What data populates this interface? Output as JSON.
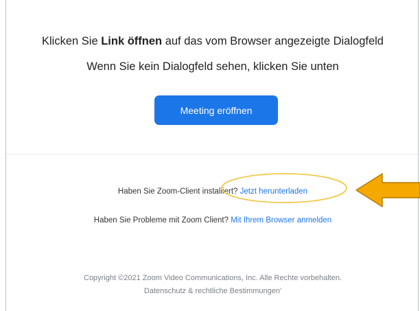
{
  "prompt": {
    "line1_prefix": "Klicken Sie ",
    "line1_bold": "Link öffnen",
    "line1_suffix": " auf das vom Browser angezeigte Dialogfeld",
    "line2": "Wenn Sie kein Dialogfeld sehen, klicken Sie unten"
  },
  "launch_button_label": "Meeting eröffnen",
  "download_row": {
    "question": "Haben Sie Zoom-Client installiert? ",
    "link": "Jetzt herunterladen"
  },
  "browser_row": {
    "question": "Haben Sie Probleme mit Zoom Client? ",
    "link": "Mit Ihrem Browser anmelden"
  },
  "footer": {
    "copyright": "Copyright ©2021 Zoom Video Communications, Inc. Alle Rechte vorbehalten.",
    "legal": "Datenschutz & rechtliche Bestimmungen'"
  },
  "annotation": {
    "highlight_color": "#f2c94c",
    "arrow_color": "#f5a800",
    "arrow_stroke": "#b07a00"
  },
  "colors": {
    "accent": "#1b76e8"
  }
}
